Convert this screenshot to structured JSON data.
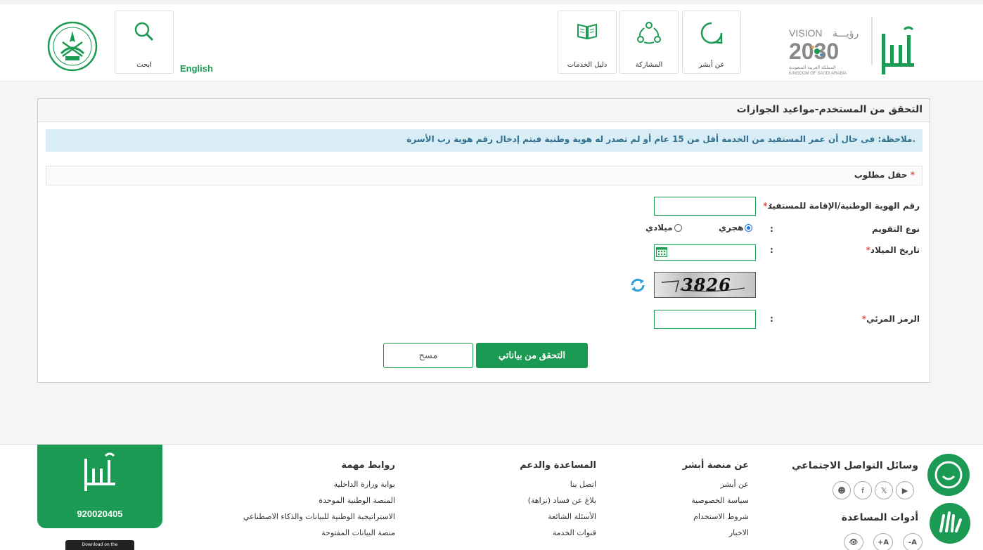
{
  "header": {
    "nav": [
      {
        "label": "عن أبشر",
        "icon": "chat-bubble-icon"
      },
      {
        "label": "المشاركة",
        "icon": "share-network-icon"
      },
      {
        "label": "دليل الخدمات",
        "icon": "book-icon"
      }
    ],
    "search_label": "ابحث",
    "language_link": "English",
    "vision_text": "VISION",
    "vision_arabic": "رؤيـــة",
    "vision_year": "2030",
    "vision_kingdom_ar": "المملكة العربية السعودية",
    "vision_kingdom_en": "KINGDOM OF SAUDI ARABIA"
  },
  "form": {
    "title": "التحقق من المستخدم-مواعيد الجوازات",
    "note": "ملاحظة: فى حال أن عمر المستفيد من الخدمة أقل من 15 عام أو لم تصدر له هوية وطنية فيتم إدخال رقم هوية رب الأسرة.",
    "required_text": "حقل مطلوب",
    "required_star": "*",
    "id_label": "رقم الهوية الوطنية/الإقامة للمستفيد",
    "calendar_label": "نوع التقويم",
    "hijri_label": "هجري",
    "gregorian_label": "ميلادي",
    "dob_label": "تاريخ الميلاد",
    "captcha_label": "الرمز المرئي",
    "captcha_text": "3826",
    "colon": ":",
    "submit_label": "التحقق من بياناتي",
    "clear_label": "مسح"
  },
  "footer": {
    "phone": "920020405",
    "appstore_text": "Download on the",
    "social_title": "وسائل التواصل الاجتماعي",
    "help_title": "أدوات المساعدة",
    "tools": [
      "-A",
      "+A"
    ],
    "col_about": {
      "title": "عن منصة أبشر",
      "links": [
        "عن أبشر",
        "سياسة الخصوصية",
        "شروط الاستخدام",
        "الاخبار"
      ]
    },
    "col_support": {
      "title": "المساعدة والدعم",
      "links": [
        "اتصل بنا",
        "بلاغ عن فساد (نزاهة)",
        "الأسئلة الشائعة",
        "قنوات الخدمة"
      ]
    },
    "col_links": {
      "title": "روابط مهمة",
      "links": [
        "بوابة وزارة الداخلية",
        "المنصة الوطنية الموحدة",
        "الاستراتيجية الوطنية للبيانات والذكاء الاصطناعي",
        "منصة البيانات المفتوحة"
      ]
    }
  },
  "colors": {
    "brand_green": "#1a9a52",
    "note_bg": "#d9edf7",
    "note_text": "#31708f"
  }
}
